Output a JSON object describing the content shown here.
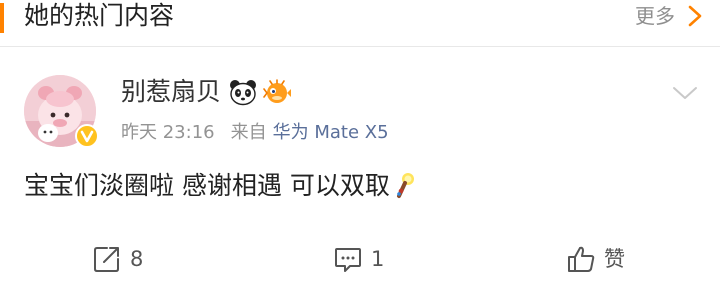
{
  "section": {
    "title": "她的热门内容",
    "more_label": "更多",
    "accent_color": "#ff8200"
  },
  "post": {
    "author": {
      "name": "别惹扇贝",
      "emojis": [
        "panda-face-icon",
        "pufferfish-icon"
      ],
      "verified": true,
      "badge_color": "#ffc21f"
    },
    "meta": {
      "time": "昨天 23:16",
      "source_prefix": "来自",
      "device": "华为 Mate X5",
      "device_color": "#5a6f9a"
    },
    "text": "宝宝们淡圈啦 感谢相遇 可以双取",
    "text_emoji": "torch-icon",
    "actions": {
      "repost": {
        "icon": "repost-icon",
        "count": "8"
      },
      "comment": {
        "icon": "comment-icon",
        "count": "1"
      },
      "like": {
        "icon": "thumbs-up-icon",
        "label": "赞"
      }
    }
  }
}
